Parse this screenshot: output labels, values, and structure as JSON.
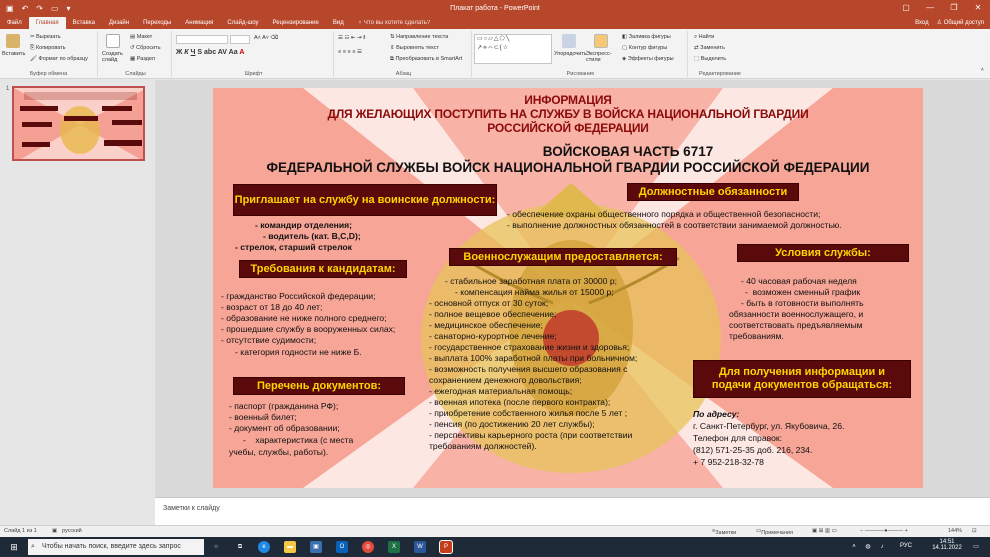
{
  "window": {
    "title": "Плакат работа - PowerPoint",
    "sign_in": "Вход",
    "share": "Общий доступ",
    "accent": "#b7472a"
  },
  "tabs": [
    "Файл",
    "Главная",
    "Вставка",
    "Дизайн",
    "Переходы",
    "Анимация",
    "Слайд-шоу",
    "Рецензирование",
    "Вид"
  ],
  "tell_me": "Что вы хотите сделать?",
  "ribbon": {
    "paste": "Вставить",
    "cut": "Вырезать",
    "copy": "Копировать",
    "format_painter": "Формат по образцу",
    "clipboard": "Буфер обмена",
    "new_slide": "Создать слайд",
    "layout": "Макет",
    "reset": "Сбросить",
    "section": "Раздел",
    "slides": "Слайды",
    "font": "Шрифт",
    "text_direction": "Направление текста",
    "align_text": "Выровнять текст",
    "smartart": "Преобразовать в SmartArt",
    "paragraph": "Абзац",
    "arrange": "Упорядочить",
    "quick_styles": "Экспресс-стили",
    "shape_fill": "Заливка фигуры",
    "shape_outline": "Контур фигуры",
    "shape_effects": "Эффекты фигуры",
    "drawing": "Рисование",
    "find": "Найти",
    "replace": "Заменить",
    "select": "Выделить",
    "editing": "Редактирование"
  },
  "thumb_number": "1",
  "slide": {
    "heading_red": [
      "ИНФОРМАЦИЯ",
      "ДЛЯ ЖЕЛАЮЩИХ ПОСТУПИТЬ НА СЛУЖБУ В ВОЙСКА НАЦИОНАЛЬНОЙ ГВАРДИИ",
      "РОССИЙСКОЙ ФЕДЕРАЦИИ"
    ],
    "heading_black": [
      "ВОЙСКОВАЯ ЧАСТЬ 6717",
      "ФЕДЕРАЛЬНОЙ СЛУЖБЫ ВОЙСК НАЦИОНАЛЬНОЙ ГВАРДИИ РОССИЙСКОЙ ФЕДЕРАЦИИ"
    ],
    "box_invite": "Приглашает на службу на воинские должности:",
    "invite_list": [
      "- командир отделения;",
      "- водитель (кат. В,С,D);",
      "- стрелок, старший стрелок"
    ],
    "box_duties": "Должностные обязанности",
    "duties_list": [
      "- обеспечение охраны общественного порядка и общественной безопасности;",
      "- выполнение должностных обязанностей в соответствии занимаемой должностью."
    ],
    "box_requirements": "Требования к кандидатам:",
    "requirements_list": [
      "- гражданство Российской федерации;",
      "- возраст от 18 до 40 лет;",
      "- образование не ниже полного среднего;",
      "- прошедшие службу в вооруженных силах;",
      "- отсутствие судимости;",
      "- категория годности не ниже Б."
    ],
    "box_provided": "Военнослужащим предоставляется:",
    "provided_list": [
      "- стабильное заработная плата от 30000 р;",
      "- компенсация найма жилья от 15000 р;",
      "- основной отпуск от 30 суток;",
      "- полное вещевое обеспечение;",
      "- медицинское обеспечение;",
      "- санаторно-курортное лечение;",
      "- государственное страхование жизни и здоровья;",
      "- выплата 100% заработной платы при больничном;",
      "- возможность получения высшего образования с",
      "сохранением денежного довольствия;",
      "- ежегодная материальная помощь;",
      "- военная ипотека (после первого контракта);",
      "- приобретение собственного жилья после 5 лет ;",
      "- пенсия (по достижению 20 лет службы);",
      "- перспективы карьерного роста (при соответствии",
      "требованиям должностей)."
    ],
    "box_conditions": "Условия службы:",
    "conditions_list": [
      "- 40 часовая рабочая неделя",
      "-  возможен сменный график",
      "- быть в готовности выполнять",
      "обязанности военнослужащего, и",
      "соответствовать предъявляемым",
      "требованиям."
    ],
    "box_documents": "Перечень документов:",
    "documents_list": [
      "- паспорт (гражданина РФ);",
      "- военный билет;",
      "- документ об образовании;",
      "-    характеристика (с места",
      "учебы, службы, работы)."
    ],
    "box_contact": "Для получения информации и подачи документов обращаться:",
    "contact_address_label": "По адресу:",
    "contact_list": [
      "г. Санкт-Петербург, ул. Якубовича, 26.",
      "Телефон для справок:",
      "(812) 571-25-35 доб. 216, 234.",
      "+ 7 952-218-32-78"
    ]
  },
  "notes_placeholder": "Заметки к слайду",
  "status": {
    "slide_info": "Слайд 1 из 1",
    "language": "русский",
    "notes": "Заметки",
    "comments": "Примечания",
    "zoom": "144%"
  },
  "taskbar": {
    "search_placeholder": "Чтобы начать поиск, введите здесь запрос",
    "lang": "РУС",
    "time": "14:51",
    "date": "14.11.2022"
  }
}
